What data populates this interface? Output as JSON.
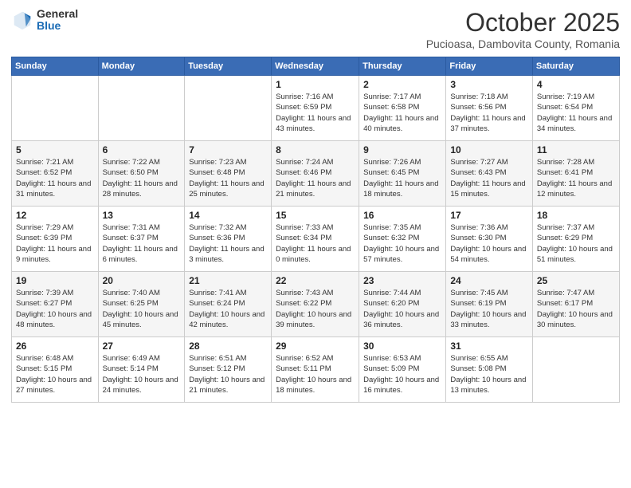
{
  "header": {
    "logo_general": "General",
    "logo_blue": "Blue",
    "month_title": "October 2025",
    "subtitle": "Pucioasa, Dambovita County, Romania"
  },
  "weekdays": [
    "Sunday",
    "Monday",
    "Tuesday",
    "Wednesday",
    "Thursday",
    "Friday",
    "Saturday"
  ],
  "weeks": [
    [
      null,
      null,
      null,
      {
        "day": "1",
        "sunrise": "7:16 AM",
        "sunset": "6:59 PM",
        "daylight": "11 hours and 43 minutes."
      },
      {
        "day": "2",
        "sunrise": "7:17 AM",
        "sunset": "6:58 PM",
        "daylight": "11 hours and 40 minutes."
      },
      {
        "day": "3",
        "sunrise": "7:18 AM",
        "sunset": "6:56 PM",
        "daylight": "11 hours and 37 minutes."
      },
      {
        "day": "4",
        "sunrise": "7:19 AM",
        "sunset": "6:54 PM",
        "daylight": "11 hours and 34 minutes."
      }
    ],
    [
      {
        "day": "5",
        "sunrise": "7:21 AM",
        "sunset": "6:52 PM",
        "daylight": "11 hours and 31 minutes."
      },
      {
        "day": "6",
        "sunrise": "7:22 AM",
        "sunset": "6:50 PM",
        "daylight": "11 hours and 28 minutes."
      },
      {
        "day": "7",
        "sunrise": "7:23 AM",
        "sunset": "6:48 PM",
        "daylight": "11 hours and 25 minutes."
      },
      {
        "day": "8",
        "sunrise": "7:24 AM",
        "sunset": "6:46 PM",
        "daylight": "11 hours and 21 minutes."
      },
      {
        "day": "9",
        "sunrise": "7:26 AM",
        "sunset": "6:45 PM",
        "daylight": "11 hours and 18 minutes."
      },
      {
        "day": "10",
        "sunrise": "7:27 AM",
        "sunset": "6:43 PM",
        "daylight": "11 hours and 15 minutes."
      },
      {
        "day": "11",
        "sunrise": "7:28 AM",
        "sunset": "6:41 PM",
        "daylight": "11 hours and 12 minutes."
      }
    ],
    [
      {
        "day": "12",
        "sunrise": "7:29 AM",
        "sunset": "6:39 PM",
        "daylight": "11 hours and 9 minutes."
      },
      {
        "day": "13",
        "sunrise": "7:31 AM",
        "sunset": "6:37 PM",
        "daylight": "11 hours and 6 minutes."
      },
      {
        "day": "14",
        "sunrise": "7:32 AM",
        "sunset": "6:36 PM",
        "daylight": "11 hours and 3 minutes."
      },
      {
        "day": "15",
        "sunrise": "7:33 AM",
        "sunset": "6:34 PM",
        "daylight": "11 hours and 0 minutes."
      },
      {
        "day": "16",
        "sunrise": "7:35 AM",
        "sunset": "6:32 PM",
        "daylight": "10 hours and 57 minutes."
      },
      {
        "day": "17",
        "sunrise": "7:36 AM",
        "sunset": "6:30 PM",
        "daylight": "10 hours and 54 minutes."
      },
      {
        "day": "18",
        "sunrise": "7:37 AM",
        "sunset": "6:29 PM",
        "daylight": "10 hours and 51 minutes."
      }
    ],
    [
      {
        "day": "19",
        "sunrise": "7:39 AM",
        "sunset": "6:27 PM",
        "daylight": "10 hours and 48 minutes."
      },
      {
        "day": "20",
        "sunrise": "7:40 AM",
        "sunset": "6:25 PM",
        "daylight": "10 hours and 45 minutes."
      },
      {
        "day": "21",
        "sunrise": "7:41 AM",
        "sunset": "6:24 PM",
        "daylight": "10 hours and 42 minutes."
      },
      {
        "day": "22",
        "sunrise": "7:43 AM",
        "sunset": "6:22 PM",
        "daylight": "10 hours and 39 minutes."
      },
      {
        "day": "23",
        "sunrise": "7:44 AM",
        "sunset": "6:20 PM",
        "daylight": "10 hours and 36 minutes."
      },
      {
        "day": "24",
        "sunrise": "7:45 AM",
        "sunset": "6:19 PM",
        "daylight": "10 hours and 33 minutes."
      },
      {
        "day": "25",
        "sunrise": "7:47 AM",
        "sunset": "6:17 PM",
        "daylight": "10 hours and 30 minutes."
      }
    ],
    [
      {
        "day": "26",
        "sunrise": "6:48 AM",
        "sunset": "5:15 PM",
        "daylight": "10 hours and 27 minutes."
      },
      {
        "day": "27",
        "sunrise": "6:49 AM",
        "sunset": "5:14 PM",
        "daylight": "10 hours and 24 minutes."
      },
      {
        "day": "28",
        "sunrise": "6:51 AM",
        "sunset": "5:12 PM",
        "daylight": "10 hours and 21 minutes."
      },
      {
        "day": "29",
        "sunrise": "6:52 AM",
        "sunset": "5:11 PM",
        "daylight": "10 hours and 18 minutes."
      },
      {
        "day": "30",
        "sunrise": "6:53 AM",
        "sunset": "5:09 PM",
        "daylight": "10 hours and 16 minutes."
      },
      {
        "day": "31",
        "sunrise": "6:55 AM",
        "sunset": "5:08 PM",
        "daylight": "10 hours and 13 minutes."
      },
      null
    ]
  ]
}
